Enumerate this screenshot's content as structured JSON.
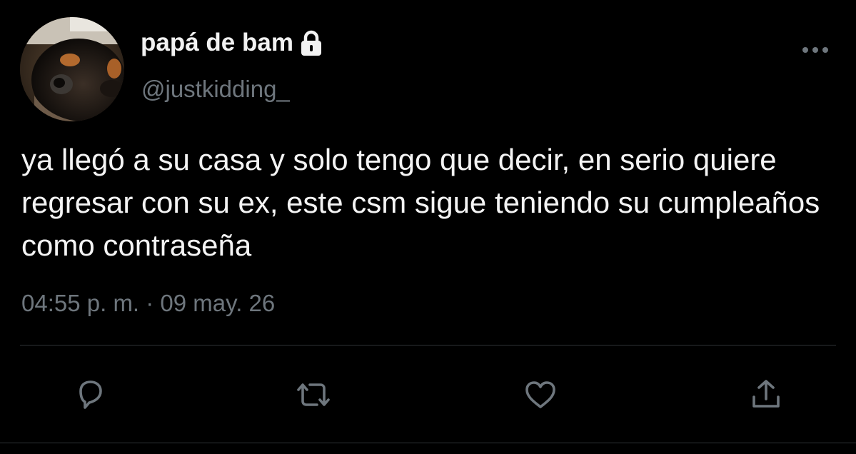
{
  "tweet": {
    "display_name": "papá de bam",
    "handle": "@justkidding_",
    "text": "ya llegó a su casa y solo tengo que decir, en serio quiere regresar con su ex, este csm sigue teniendo su cumpleaños como contraseña",
    "timestamp": "04:55 p. m. · 09 may. 26",
    "protected": true
  },
  "icons": {
    "lock": "lock-icon",
    "more": "more-options-icon",
    "reply": "reply-icon",
    "retweet": "retweet-icon",
    "like": "heart-icon",
    "share": "share-icon"
  },
  "colors": {
    "background": "#000000",
    "text_primary": "#f4f4f4",
    "text_secondary": "#6e767d",
    "icon": "#6e767d",
    "divider": "#2f3336"
  }
}
